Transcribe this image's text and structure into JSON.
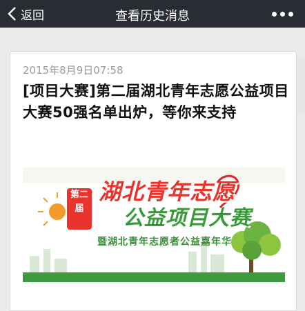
{
  "nav": {
    "back_label": "返回",
    "title": "查看历史消息"
  },
  "article": {
    "date": "2015年8月9日07:58",
    "title": "[项目大赛]第二届湖北青年志愿公益项目大赛50强名单出炉，等你来支持",
    "cover": {
      "badge": "第二届",
      "line1": "湖北青年志愿",
      "line2": "公益项目大赛",
      "subtitle": "暨湖北青年志愿者公益嘉年华"
    }
  }
}
